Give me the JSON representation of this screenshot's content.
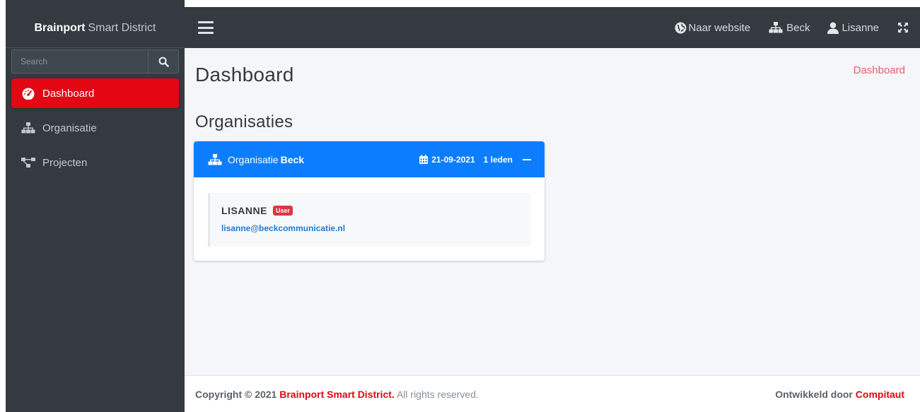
{
  "sidebar": {
    "brand_bold": "Brainport",
    "brand_light": "Smart District",
    "search_placeholder": "Search",
    "items": [
      {
        "label": "Dashboard",
        "icon": "tachometer-icon",
        "active": true
      },
      {
        "label": "Organisatie",
        "icon": "sitemap-icon",
        "active": false
      },
      {
        "label": "Projecten",
        "icon": "project-diagram-icon",
        "active": false
      }
    ]
  },
  "topbar": {
    "website_label": "Naar website",
    "org_label": "Beck",
    "user_label": "Lisanne"
  },
  "main": {
    "page_title": "Dashboard",
    "breadcrumb": "Dashboard",
    "section_title": "Organisaties",
    "organisation": {
      "prefix": "Organisatie",
      "name": "Beck",
      "date": "21-09-2021",
      "members_count": "1 leden",
      "members": [
        {
          "name": "LISANNE",
          "role": "User",
          "email": "lisanne@beckcommunicatie.nl"
        }
      ]
    }
  },
  "footer": {
    "copyright_prefix": "Copyright © 2021",
    "company": "Brainport Smart District.",
    "rights": "All rights reserved.",
    "developed_by": "Ontwikkeld door",
    "developer": "Compitaut"
  },
  "colors": {
    "sidebar_bg": "#343a40",
    "active_item": "#e30613",
    "card_header": "#0d7dff",
    "badge": "#dc3545",
    "link": "#1f7ad9"
  }
}
